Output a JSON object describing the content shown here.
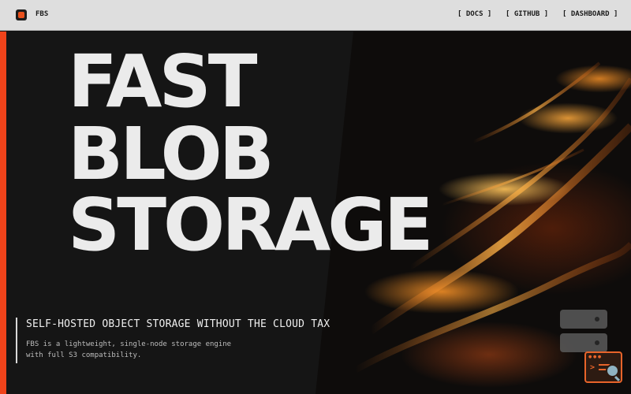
{
  "header": {
    "brand": "FBS",
    "nav": [
      {
        "label": "[ DOCS ]"
      },
      {
        "label": "[ GITHUB ]"
      },
      {
        "label": "[ DASHBOARD ]"
      }
    ]
  },
  "hero": {
    "headline": [
      "FAST",
      "BLOB",
      "STORAGE"
    ],
    "tagline": "SELF-HOSTED OBJECT STORAGE WITHOUT THE CLOUD TAX",
    "description": [
      "FBS is a lightweight, single-node storage engine",
      "with full S3 compatibility."
    ]
  },
  "colors": {
    "accent": "#f0431a",
    "header_bg": "#dedede",
    "hero_bg": "#151515"
  },
  "icons": {
    "logo": "fbs-logo-icon",
    "servers": "server-stack-icon",
    "terminal": "terminal-search-icon"
  }
}
